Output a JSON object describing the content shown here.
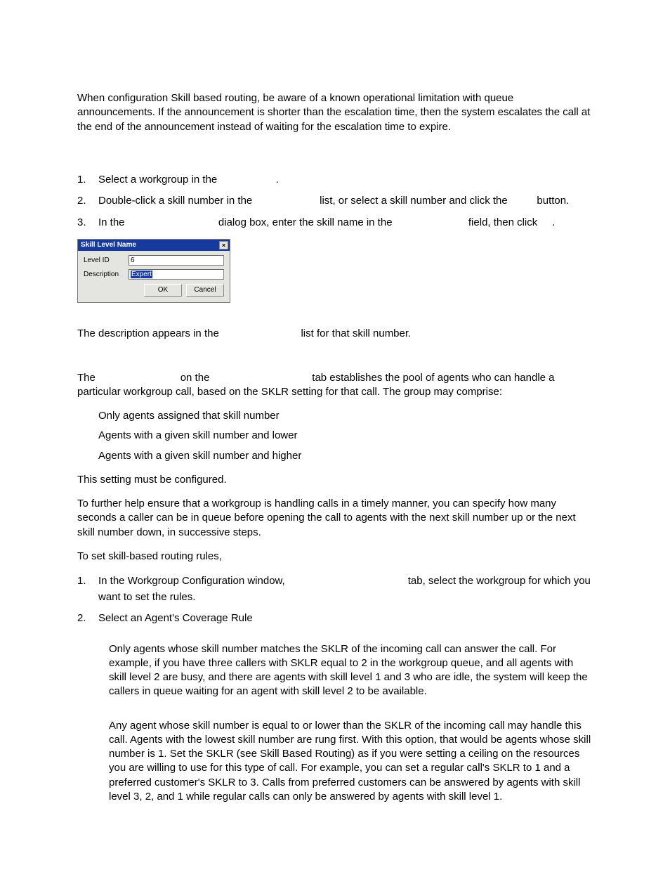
{
  "intro": "When configuration Skill based routing, be aware of a known operational limitation with queue announcements. If the announcement is shorter than the escalation time, then the system escalates the call at the end of the announcement instead of waiting for the escalation time to expire.",
  "stepsA": [
    {
      "n": "1.",
      "text": "Select a workgroup in the                    ."
    },
    {
      "n": "2.",
      "text": "Double-click a skill number in the                       list, or select a skill number and click the          button."
    },
    {
      "n": "3.",
      "text": "In the                                dialog box, enter the skill name in the                          field, then click     ."
    }
  ],
  "dialog": {
    "title": "Skill Level Name",
    "close": "×",
    "rows": [
      {
        "label": "Level ID",
        "value": "6"
      },
      {
        "label": "Description",
        "value": "Expert"
      }
    ],
    "ok": "OK",
    "cancel": "Cancel"
  },
  "afterDialog": "The description appears in the                            list for that skill number.",
  "para2": "The                             on the                                   tab establishes the pool of agents who can handle a particular workgroup call, based on the SKLR setting for that call. The group may comprise:",
  "bullets": [
    "Only agents assigned that skill number",
    "Agents with a given skill number and lower",
    "Agents with a given skill number and higher"
  ],
  "mustConfig": "This setting must be configured.",
  "furtherHelp": "To further help ensure that a workgroup is handling calls in a timely manner, you can specify how many seconds a caller can be in queue before opening the call to agents with the next skill number up or the next skill number down, in successive steps.",
  "toSet": "To set skill-based routing rules,",
  "stepsB": [
    {
      "n": "1.",
      "text": "In the Workgroup Configuration window,                                          tab, select the workgroup for which you want to set the rules."
    },
    {
      "n": "2.",
      "text": "Select an Agent's Coverage Rule"
    }
  ],
  "detail1": "Only agents whose skill number matches the SKLR of the incoming call can answer the call. For example, if you have three callers with SKLR equal to 2 in the workgroup queue, and all agents with skill level 2 are busy, and there are agents with skill level 1 and 3 who are idle, the system will keep the callers in queue waiting for an agent with skill level 2 to be available.",
  "detail2": "Any agent whose skill number is equal to or lower than the SKLR of the incoming call may handle this call. Agents with the lowest skill number are rung first. With this option, that would be agents whose skill number is 1. Set the SKLR (see Skill Based Routing) as if you were setting a ceiling on the resources you are willing to use for this type of call. For example, you can set a regular call's SKLR to 1 and a preferred customer's SKLR to 3. Calls from preferred customers can be answered by agents with skill level 3, 2, and 1 while regular calls can only be answered by agents with skill level 1."
}
